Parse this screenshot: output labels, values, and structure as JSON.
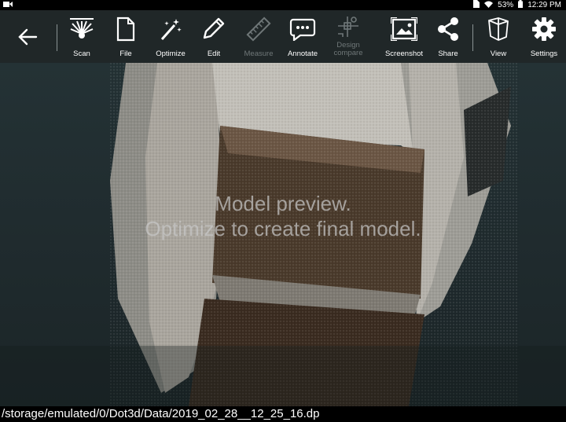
{
  "status_bar": {
    "battery": "53%",
    "time": "12:29 PM"
  },
  "toolbar": {
    "items": [
      {
        "label": "Scan"
      },
      {
        "label": "File"
      },
      {
        "label": "Optimize"
      },
      {
        "label": "Edit"
      },
      {
        "label": "Measure",
        "enabled": false
      },
      {
        "label": "Annotate"
      },
      {
        "label": "Design\ncompare",
        "enabled": false
      },
      {
        "label": "Screenshot"
      },
      {
        "label": "Share"
      },
      {
        "label": "View"
      },
      {
        "label": "Settings"
      }
    ]
  },
  "viewport": {
    "overlay_line1": "Model preview.",
    "overlay_line2": "Optimize to create final model."
  },
  "footer": {
    "file_path": "/storage/emulated/0/Dot3d/Data/2019_02_28__12_25_16.dp"
  }
}
